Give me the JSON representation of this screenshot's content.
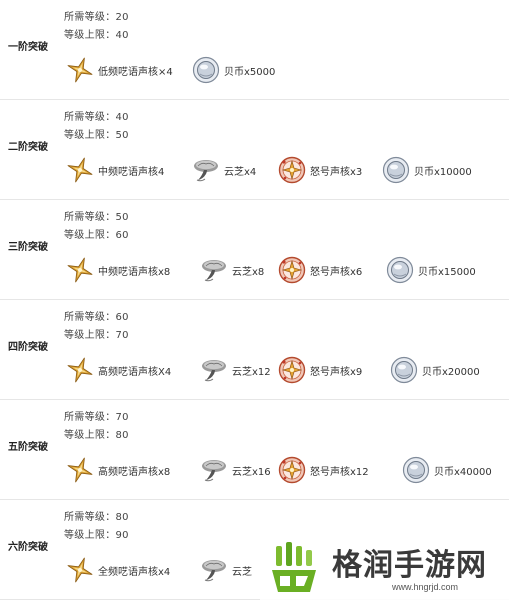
{
  "labels": {
    "required_level": "所需等级",
    "level_cap": "等级上限",
    "sep": "："
  },
  "icons": {
    "shard": "star-shard-icon",
    "mushroom": "lingzhi-mushroom-icon",
    "core": "rage-core-icon",
    "coin": "shell-coin-icon"
  },
  "tiers": [
    {
      "name": "一阶突破",
      "required_level": "20",
      "level_cap": "40",
      "materials": [
        "低频呓语声核×4",
        "贝币x5000"
      ]
    },
    {
      "name": "二阶突破",
      "required_level": "40",
      "level_cap": "50",
      "materials": [
        "中频呓语声核4",
        "云芝x4",
        "怒号声核x3",
        "贝币x10000"
      ]
    },
    {
      "name": "三阶突破",
      "required_level": "50",
      "level_cap": "60",
      "materials": [
        "中频呓语声核x8",
        "云芝x8",
        "怒号声核x6",
        "贝币x15000"
      ]
    },
    {
      "name": "四阶突破",
      "required_level": "60",
      "level_cap": "70",
      "materials": [
        "高频呓语声核X4",
        "云芝x12",
        "怒号声核x9",
        "贝币x20000"
      ]
    },
    {
      "name": "五阶突破",
      "required_level": "70",
      "level_cap": "80",
      "materials": [
        "高频呓语声核x8",
        "云芝x16",
        "怒号声核x12",
        "贝币x40000"
      ]
    },
    {
      "name": "六阶突破",
      "required_level": "80",
      "level_cap": "90",
      "materials": [
        "全频呓语声核x4",
        "云芝"
      ]
    }
  ],
  "watermark": {
    "title": "格润手游网",
    "url": "www.hngrjd.com"
  }
}
